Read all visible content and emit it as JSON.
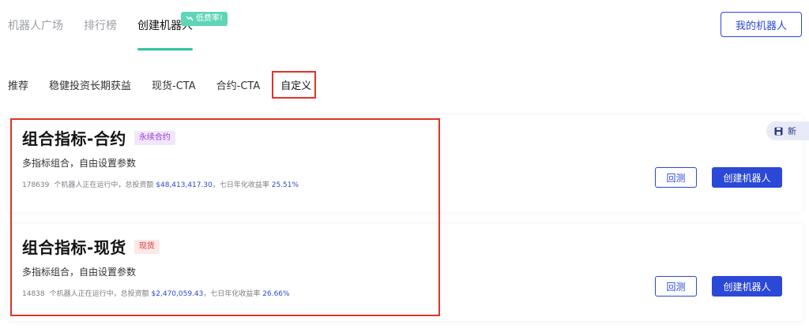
{
  "top_tabs": [
    {
      "label": "机器人广场",
      "active": false
    },
    {
      "label": "排行榜",
      "active": false
    },
    {
      "label": "创建机器人",
      "active": true
    }
  ],
  "fee_badge": "低费率!",
  "my_robot_button": "我的机器人",
  "category_tabs": [
    {
      "label": "推荐"
    },
    {
      "label": "稳健投资长期获益"
    },
    {
      "label": "现货-CTA"
    },
    {
      "label": "合约-CTA"
    },
    {
      "label": "自定义",
      "active": true
    }
  ],
  "new_badge": "新",
  "cards": [
    {
      "title": "组合指标-合约",
      "tag": "永续合约",
      "description": "多指标组合，自由设置参数",
      "running_count": "178639",
      "running_text": "个机器人正在运行中，总投资额",
      "total_investment": "$48,413,417.30",
      "apr_label": "，七日年化收益率",
      "apr": "25.51%",
      "backtest_label": "回测",
      "create_label": "创建机器人"
    },
    {
      "title": "组合指标-现货",
      "tag": "现货",
      "description": "多指标组合，自由设置参数",
      "running_count": "14838",
      "running_text": "个机器人正在运行中，总投资额",
      "total_investment": "$2,470,059.43",
      "apr_label": "，七日年化收益率",
      "apr": "26.66%",
      "backtest_label": "回测",
      "create_label": "创建机器人"
    }
  ],
  "colors": {
    "accent": "#2b48d6",
    "highlight": "#e2322a",
    "tab_underline": "#2ec4a0"
  }
}
